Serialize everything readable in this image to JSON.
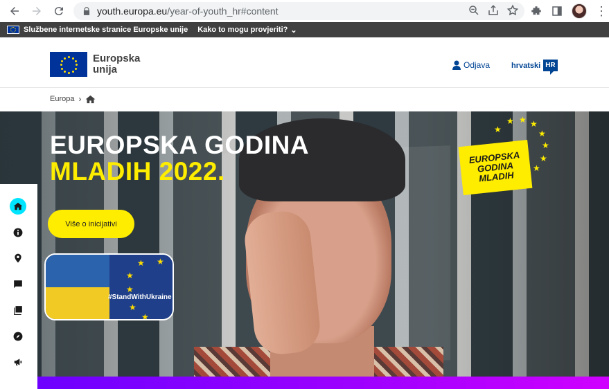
{
  "browser": {
    "url_host": "youth.europa.eu",
    "url_path": "/year-of-youth_hr#content"
  },
  "eu_bar": {
    "official_text": "Službene internetske stranice Europske unije",
    "how_to_check": "Kako to mogu provjeriti?"
  },
  "header": {
    "logo_line1": "Europska",
    "logo_line2": "unija",
    "logout_label": "Odjava",
    "language_label": "hrvatski",
    "language_code": "HR"
  },
  "breadcrumb": {
    "item1": "Europa"
  },
  "hero": {
    "title_line1": "EUROPSKA GODINA",
    "title_line2": "MLADIH 2022.",
    "cta_label": "Više o inicijativi",
    "ukraine_tag": "#StandWithUkraine",
    "badge_line1": "EUROPSKA",
    "badge_line2": "GODINA",
    "badge_line3": "MLADIH"
  },
  "side_nav": {
    "items": [
      "home-icon",
      "info-icon",
      "location-icon",
      "chat-icon",
      "library-icon",
      "compass-icon",
      "megaphone-icon"
    ]
  },
  "colors": {
    "eu_blue": "#003399",
    "yellow": "#ffed00",
    "link_blue": "#004494",
    "active_nav": "#00e5ff",
    "bottom_gradient_start": "#6d00ff",
    "bottom_gradient_end": "#d000ff"
  }
}
